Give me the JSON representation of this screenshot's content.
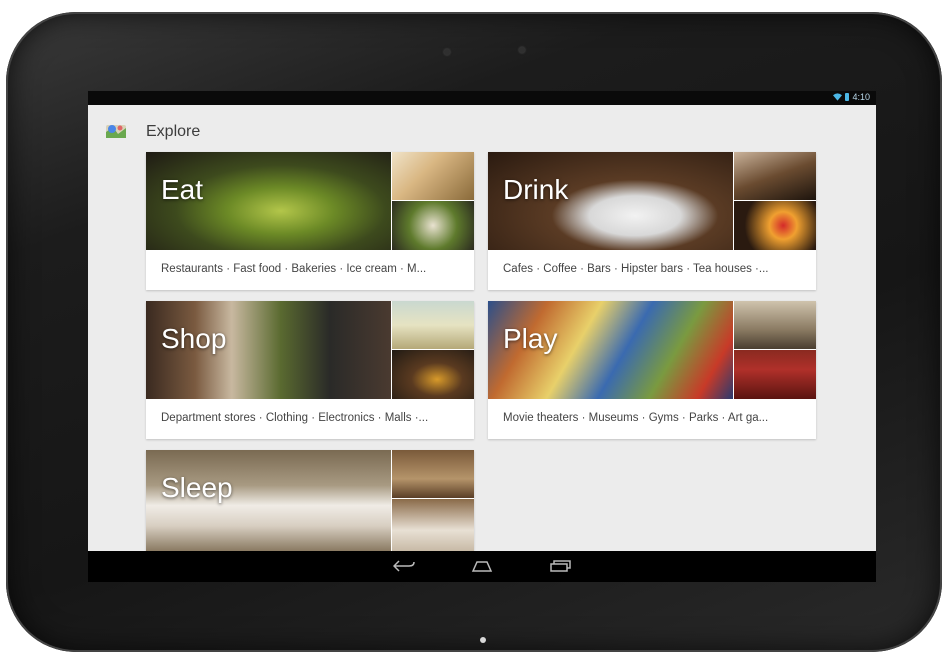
{
  "status_bar": {
    "time": "4:10",
    "icons": [
      "wifi-icon",
      "battery-icon"
    ]
  },
  "action_bar": {
    "title": "Explore",
    "app_icon": "explore-map-icon"
  },
  "categories": [
    {
      "title": "Eat",
      "links": "Restaurants · Fast food · Bakeries · Ice cream · M..."
    },
    {
      "title": "Drink",
      "links": "Cafes · Coffee · Bars · Hipster bars · Tea houses ·..."
    },
    {
      "title": "Shop",
      "links": "Department stores · Clothing · Electronics · Malls ·..."
    },
    {
      "title": "Play",
      "links": "Movie theaters · Museums · Gyms · Parks · Art ga..."
    },
    {
      "title": "Sleep",
      "links": ""
    }
  ],
  "nav_bar": {
    "icons": [
      "back-icon",
      "home-icon",
      "recent-apps-icon"
    ]
  },
  "colors": {
    "app_background": "#ececec",
    "card_background": "#ffffff",
    "status_accent": "#4cb7e6"
  }
}
